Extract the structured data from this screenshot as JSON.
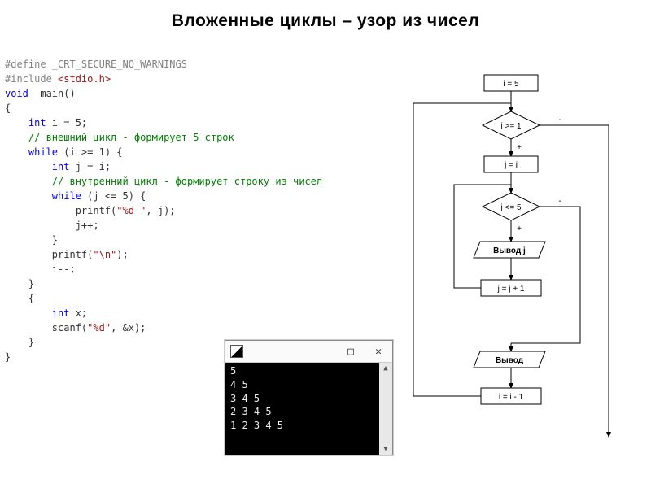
{
  "title": "Вложенные циклы – узор из чисел",
  "code": {
    "l1a": "#define ",
    "l1b": "_CRT_SECURE_NO_WARNINGS",
    "l2a": "#include ",
    "l2b": "<stdio.h>",
    "l3": "",
    "l4a": "void",
    "l4b": "  main()",
    "l5": "{",
    "l6a": "    int",
    "l6b": " i = 5;",
    "l7": "    // внешний цикл - формирует 5 строк",
    "l8a": "    while",
    "l8b": " (i >= 1) {",
    "l9a": "        int",
    "l9b": " j = i;",
    "l10": "        // внутренний цикл - формирует строку из чисел",
    "l11a": "        while",
    "l11b": " (j <= 5) {",
    "l12": "            printf(",
    "l12s": "\"%d \"",
    "l12e": ", j);",
    "l13": "            j++;",
    "l14": "        }",
    "l15": "        printf(",
    "l15s": "\"\\n\"",
    "l15e": ");",
    "l16": "        i--;",
    "l17": "    }",
    "l18": "",
    "l19": "    {",
    "l20a": "        int",
    "l20b": " x;",
    "l21": "        scanf(",
    "l21s": "\"%d\"",
    "l21e": ", &x);",
    "l22": "    }",
    "l23": "}"
  },
  "console": {
    "lines": [
      "5",
      "4 5",
      "3 4 5",
      "2 3 4 5",
      "1 2 3 4 5"
    ]
  },
  "flow": {
    "b1": "i = 5",
    "d1": "i >= 1",
    "b2": "j = i",
    "d2": "j <= 5",
    "p1": "Вывод j",
    "b3": "j = j + 1",
    "p2": "Вывод",
    "b4": "i = i - 1",
    "plus": "+",
    "minus": "-"
  }
}
